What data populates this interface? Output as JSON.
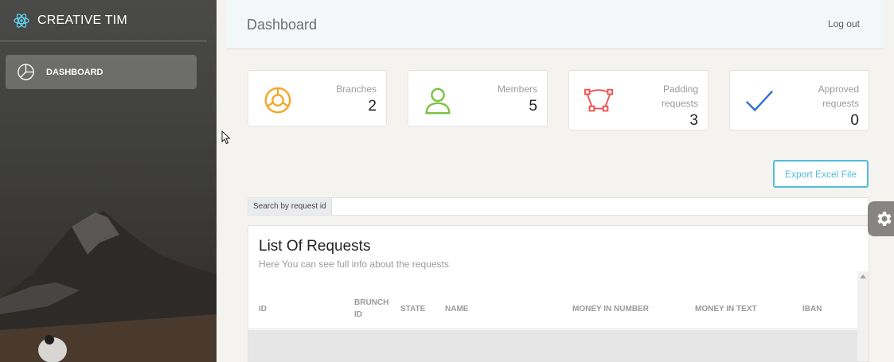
{
  "sidebar": {
    "brand": "CREATIVE TIM",
    "brand_icon": "react-atom-icon",
    "items": [
      {
        "label": "DASHBOARD",
        "icon": "pie-chart-icon",
        "active": true
      }
    ]
  },
  "header": {
    "title": "Dashboard",
    "logout_label": "Log out"
  },
  "stats": [
    {
      "label": "Branches",
      "value": "2",
      "icon": "chart-ring-icon",
      "color": "#f5a623"
    },
    {
      "label": "Members",
      "value": "5",
      "icon": "user-icon",
      "color": "#7ac142"
    },
    {
      "label_line1": "Padding",
      "label_line2": "requests",
      "value": "3",
      "icon": "vector-path-icon",
      "color": "#ef5350"
    },
    {
      "label_line1": "Approved",
      "label_line2": "requests",
      "value": "0",
      "icon": "checkmark-icon",
      "color": "#2f6fd6"
    }
  ],
  "export_button": "Export Excel File",
  "search": {
    "label": "Search by request id",
    "value": ""
  },
  "table": {
    "title": "List Of Requests",
    "subtitle": "Here You can see full info about the requests",
    "columns": [
      "ID",
      "BRUNCH ID",
      "STATE",
      "NAME",
      "MONEY IN NUMBER",
      "MONEY IN TEXT",
      "IBAN"
    ],
    "brunch_line1": "BRUNCH",
    "brunch_line2": "ID"
  },
  "colors": {
    "accent": "#51bcda",
    "sidebar_bg": "#3f3f3d"
  }
}
